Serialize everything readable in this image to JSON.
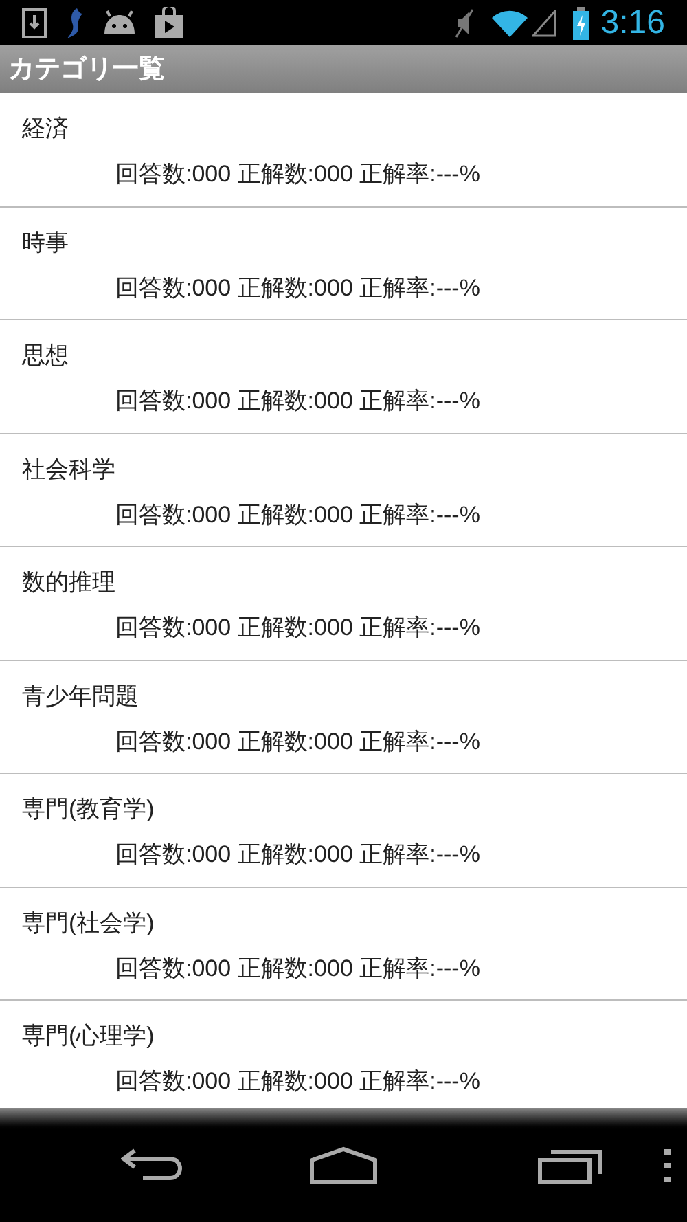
{
  "status_bar": {
    "time": "3:16"
  },
  "title_bar": {
    "title": "カテゴリ一覧"
  },
  "categories": [
    {
      "name": "経済",
      "stats": "回答数:000 正解数:000 正解率:---%"
    },
    {
      "name": "時事",
      "stats": "回答数:000 正解数:000 正解率:---%"
    },
    {
      "name": "思想",
      "stats": "回答数:000 正解数:000 正解率:---%"
    },
    {
      "name": "社会科学",
      "stats": "回答数:000 正解数:000 正解率:---%"
    },
    {
      "name": "数的推理",
      "stats": "回答数:000 正解数:000 正解率:---%"
    },
    {
      "name": "青少年問題",
      "stats": "回答数:000 正解数:000 正解率:---%"
    },
    {
      "name": "専門(教育学)",
      "stats": "回答数:000 正解数:000 正解率:---%"
    },
    {
      "name": "専門(社会学)",
      "stats": "回答数:000 正解数:000 正解率:---%"
    },
    {
      "name": "専門(心理学)",
      "stats": "回答数:000 正解数:000 正解率:---%"
    }
  ]
}
